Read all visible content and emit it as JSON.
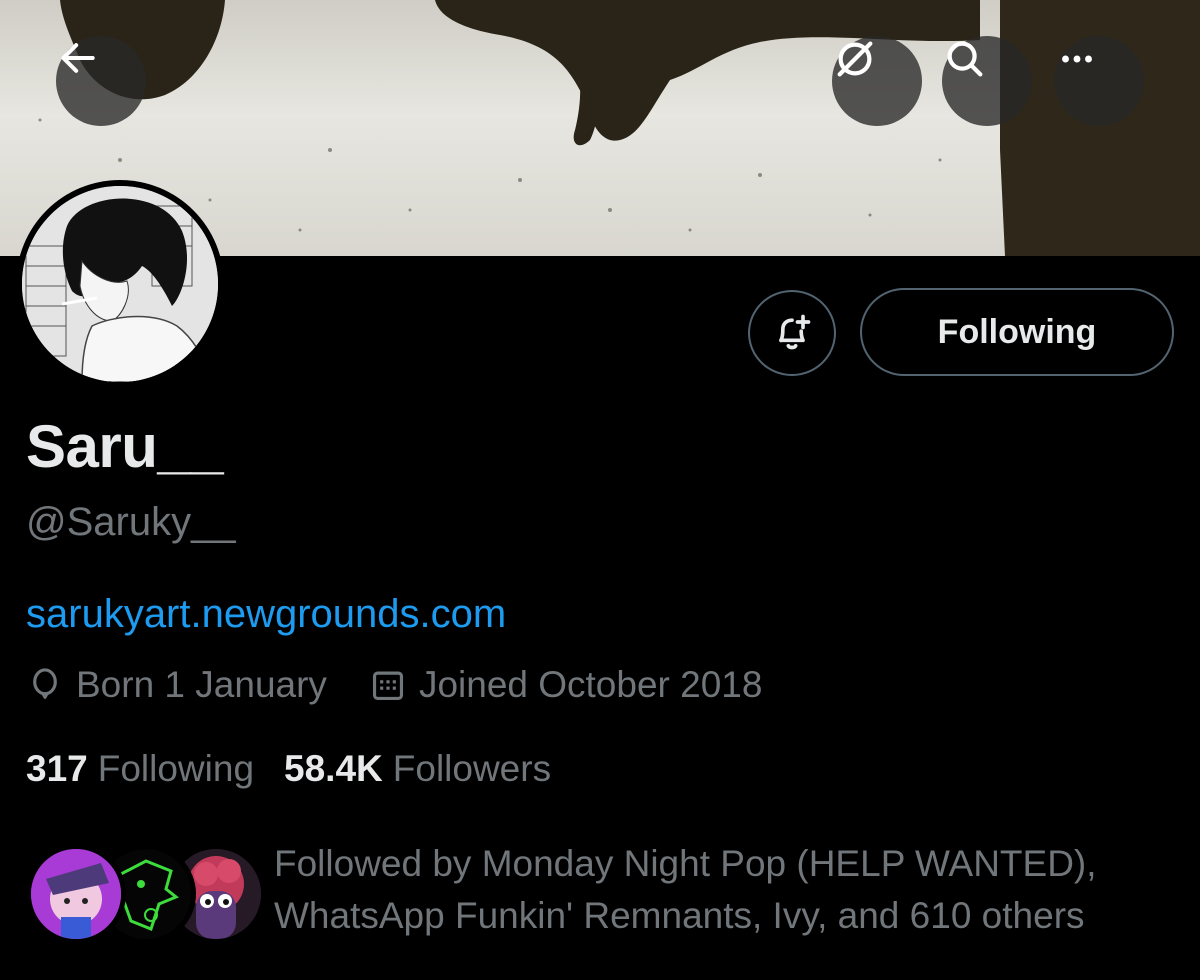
{
  "header": {
    "back_icon": "arrow-left-icon",
    "grok_icon": "grok-icon",
    "search_icon": "search-icon",
    "more_icon": "more-horizontal-icon"
  },
  "profile": {
    "display_name": "Saru__",
    "handle": "@Saruky__",
    "website": "sarukyart.newgrounds.com",
    "birthday": "Born 1 January",
    "joined": "Joined October 2018",
    "following_count": "317",
    "following_label": "Following",
    "followers_count": "58.4K",
    "followers_label": "Followers"
  },
  "actions": {
    "notify_icon": "bell-plus-icon",
    "following_button": "Following"
  },
  "followed_by": {
    "text_line1": "Followed by Monday Night Pop (HELP WANTED),",
    "text_line2": "WhatsApp Funkin' Remnants, Ivy, and 610 others"
  },
  "colors": {
    "background": "#000000",
    "primary_text": "#e7e9ea",
    "secondary_text": "#71767b",
    "link": "#1d9bf0",
    "border": "#536471"
  }
}
